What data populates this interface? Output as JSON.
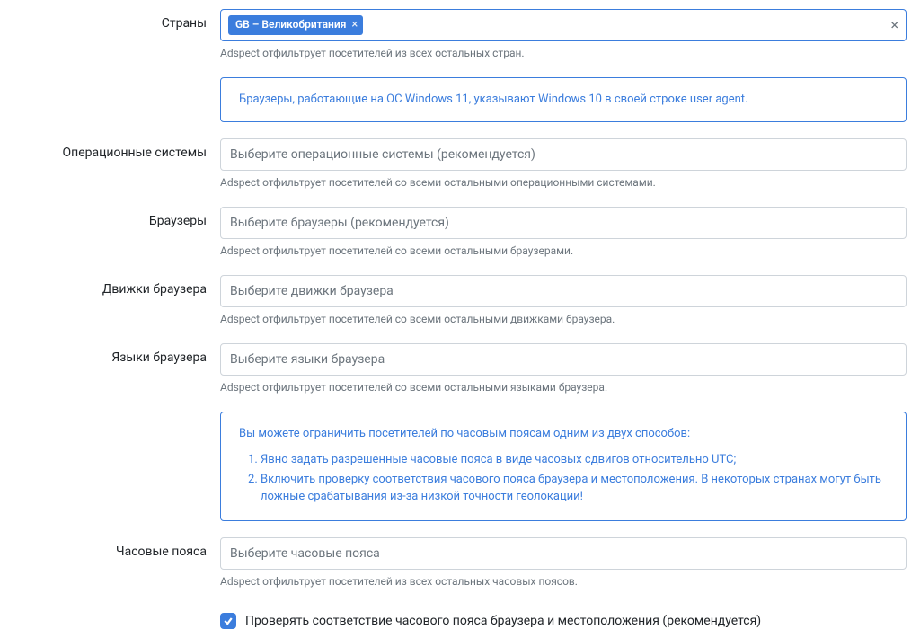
{
  "countries": {
    "label": "Страны",
    "tag": "GB – Великобритания",
    "help": "Adspect отфильтрует посетителей из всех остальных стран."
  },
  "os_alert": "Браузеры, работающие на ОС Windows 11, указывают Windows 10 в своей строке user agent.",
  "os": {
    "label": "Операционные системы",
    "placeholder": "Выберите операционные системы (рекомендуется)",
    "help": "Adspect отфильтрует посетителей со всеми остальными операционными системами."
  },
  "browsers": {
    "label": "Браузеры",
    "placeholder": "Выберите браузеры (рекомендуется)",
    "help": "Adspect отфильтрует посетителей со всеми остальными браузерами."
  },
  "engines": {
    "label": "Движки браузера",
    "placeholder": "Выберите движки браузера",
    "help": "Adspect отфильтрует посетителей со всеми остальными движками браузера."
  },
  "languages": {
    "label": "Языки браузера",
    "placeholder": "Выберите языки браузера",
    "help": "Adspect отфильтрует посетителей со всеми остальными языками браузера."
  },
  "tz_alert": {
    "intro": "Вы можете ограничить посетителей по часовым поясам одним из двух способов:",
    "item1": "Явно задать разрешенные часовые пояса в виде часовых сдвигов относительно UTC;",
    "item2": "Включить проверку соответствия часового пояса браузера и местоположения. В некоторых странах могут быть ложные срабатывания из-за низкой точности геолокации!"
  },
  "timezones": {
    "label": "Часовые пояса",
    "placeholder": "Выберите часовые пояса",
    "help": "Adspect отфильтрует посетителей из всех остальных часовых поясов."
  },
  "tz_check": {
    "label": "Проверять соответствие часового пояса браузера и местоположения (рекомендуется)"
  }
}
